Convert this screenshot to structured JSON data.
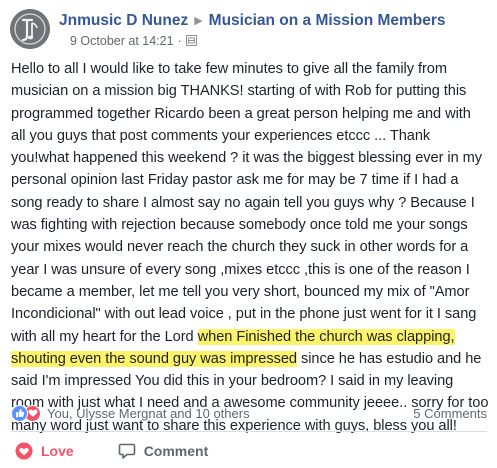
{
  "post": {
    "author": "Jnmusic D Nunez",
    "group": "Musician on a Mission Members",
    "timestamp": "9 October at 14:21",
    "meta_separator": "·",
    "body_before": "Hello to all I would like to take few minutes to give all the family from musician on a mission big THANKS! starting of with Rob for putting this programmed together Ricardo been a great person helping me and with all you guys that post comments your experiences etccc ... Thank you!what happened this weekend ? it was the biggest blessing ever in my personal opinion last Friday pastor ask me for may be 7 time if I had a song ready to share I almost say no again tell you guys why ? Because I was fighting with rejection because somebody once told me your songs your mixes would never reach the church they suck in other words for a year I was unsure of every song ,mixes etccc ,this is one of the reason I became a member, let me tell you very short, bounced my mix of \"Amor Incondicional\" with out lead voice , put in the phone just went for it I sang with all my heart for the Lord ",
    "body_highlight": "when Finished the church was clapping, shouting even the sound guy was impressed",
    "body_after": " since he has estudio and he said I'm impressed You did this in your bedroom? I said in my leaving room with just what I need and a awesome community jeeee.. sorry for too many word just want to share this experience with guys, bless you all!",
    "highlight_color": "#fdf46a"
  },
  "reactions": {
    "icons": [
      "like-icon",
      "love-icon"
    ],
    "names": "You, Ulysse Mergnat and 10 others",
    "comments": "5 Comments"
  },
  "actions": {
    "love_label": "Love",
    "comment_label": "Comment"
  },
  "colors": {
    "link": "#365899",
    "love": "#f25268",
    "like": "#5890ff",
    "muted": "#616770"
  }
}
